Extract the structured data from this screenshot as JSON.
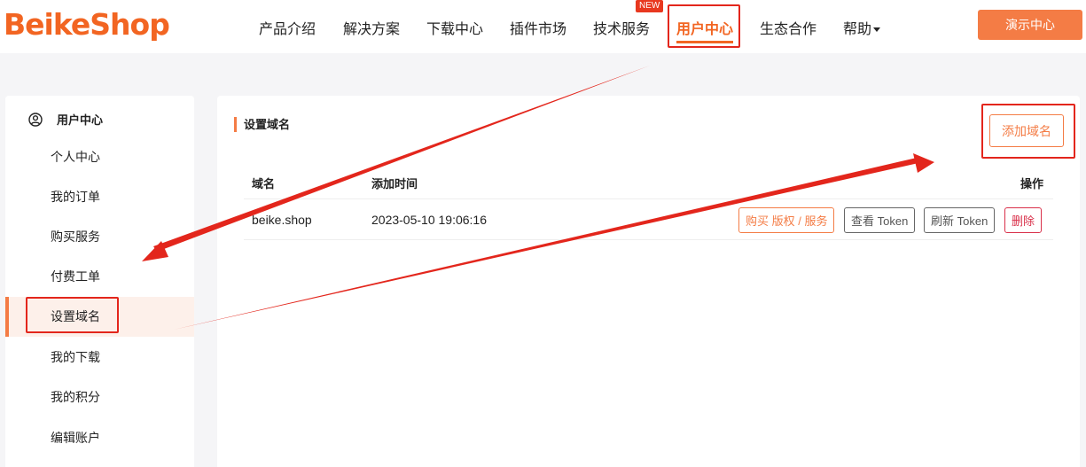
{
  "header": {
    "logo": "BeikeShop",
    "nav": [
      {
        "label": "产品介绍"
      },
      {
        "label": "解决方案"
      },
      {
        "label": "下载中心"
      },
      {
        "label": "插件市场"
      },
      {
        "label": "技术服务",
        "badge": "NEW"
      },
      {
        "label": "用户中心",
        "active": true
      },
      {
        "label": "生态合作"
      },
      {
        "label": "帮助"
      }
    ],
    "demo_button": "演示中心"
  },
  "sidebar": {
    "title": "用户中心",
    "items": [
      {
        "label": "个人中心"
      },
      {
        "label": "我的订单"
      },
      {
        "label": "购买服务"
      },
      {
        "label": "付费工单"
      },
      {
        "label": "设置域名",
        "active": true
      },
      {
        "label": "我的下载"
      },
      {
        "label": "我的积分"
      },
      {
        "label": "编辑账户"
      }
    ]
  },
  "main": {
    "title": "设置域名",
    "add_button": "添加域名",
    "table": {
      "headers": [
        "域名",
        "添加时间",
        "操作"
      ],
      "rows": [
        {
          "domain": "beike.shop",
          "added_time": "2023-05-10 19:06:16",
          "actions": [
            "购买 版权 / 服务",
            "查看 Token",
            "刷新 Token",
            "删除"
          ]
        }
      ]
    }
  },
  "colors": {
    "accent": "#f47c45",
    "brand": "#f26522",
    "danger": "#d9304a",
    "annotation": "#e3261c"
  }
}
